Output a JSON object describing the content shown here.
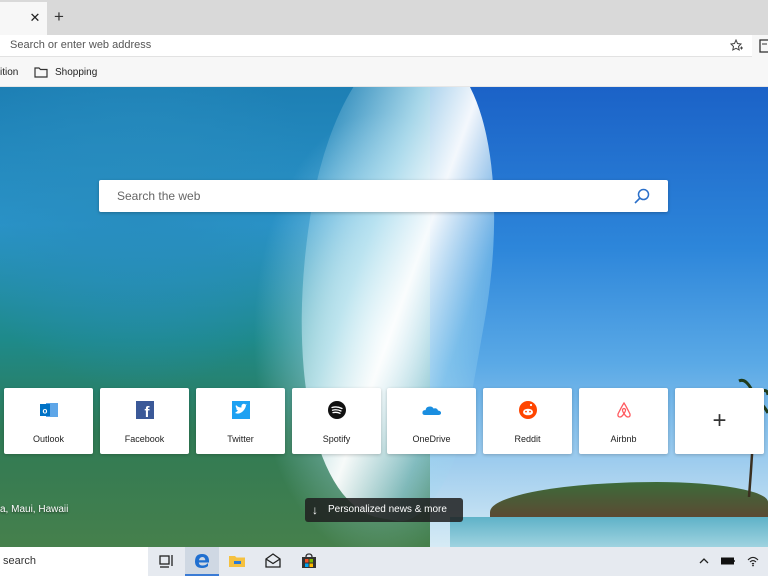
{
  "tabs": {
    "close_label": "✕",
    "new_tab_label": "+"
  },
  "address_bar": {
    "placeholder": "Search or enter web address",
    "favorite_icon": "star-add-icon",
    "reading_icon": "reading-view-icon"
  },
  "favorites_bar": {
    "items": [
      {
        "label": "ition"
      },
      {
        "label": "Shopping",
        "icon": "folder-icon"
      }
    ]
  },
  "new_tab_page": {
    "search_placeholder": "Search the web",
    "top_sites": [
      {
        "label": "Outlook",
        "icon": "outlook-icon",
        "color": "#0072c6"
      },
      {
        "label": "Facebook",
        "icon": "facebook-icon",
        "color": "#3b5998"
      },
      {
        "label": "Twitter",
        "icon": "twitter-icon",
        "color": "#1da1f2"
      },
      {
        "label": "Spotify",
        "icon": "spotify-icon",
        "color": "#111111"
      },
      {
        "label": "OneDrive",
        "icon": "onedrive-icon",
        "color": "#1a8ee0"
      },
      {
        "label": "Reddit",
        "icon": "reddit-icon",
        "color": "#ff4500"
      },
      {
        "label": "Airbnb",
        "icon": "airbnb-icon",
        "color": "#ff5a5f"
      }
    ],
    "add_site_label": "+",
    "image_location": "a, Maui, Hawaii",
    "news_button": "Personalized news & more"
  },
  "taskbar": {
    "search_text": "search",
    "apps": [
      "task-view-icon",
      "edge-icon",
      "file-explorer-icon",
      "mail-icon",
      "store-icon"
    ],
    "tray": [
      "chevron-up-icon",
      "battery-icon",
      "wifi-icon"
    ]
  }
}
